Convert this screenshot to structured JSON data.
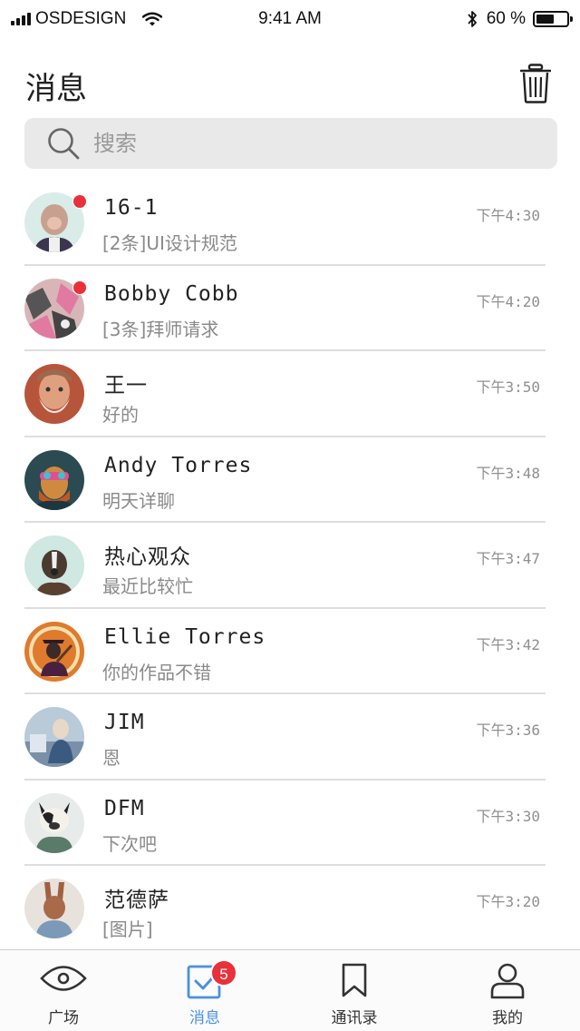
{
  "status_bar": {
    "carrier": "OSDESIGN",
    "time": "9:41 AM",
    "battery": "60 %",
    "battery_level": 0.6
  },
  "header": {
    "title": "消息",
    "trash_icon": "trash-icon"
  },
  "search": {
    "placeholder": "搜索",
    "icon": "search-icon"
  },
  "conversations": [
    {
      "name": "16-1",
      "message": "[2条]UI设计规范",
      "time": "下午4:30",
      "unread": true,
      "bg": "#d9ece8"
    },
    {
      "name": "Bobby Cobb",
      "message": "[3条]拜师请求",
      "time": "下午4:20",
      "unread": true,
      "bg": "#d8b6b8"
    },
    {
      "name": "王一",
      "message": "好的",
      "time": "下午3:50",
      "unread": false,
      "bg": "#b7553a"
    },
    {
      "name": "Andy Torres",
      "message": "明天详聊",
      "time": "下午3:48",
      "unread": false,
      "bg": "#2c4a52"
    },
    {
      "name": "热心观众",
      "message": "最近比较忙",
      "time": "下午3:47",
      "unread": false,
      "bg": "#cfe8e1"
    },
    {
      "name": "Ellie Torres",
      "message": "你的作品不错",
      "time": "下午3:42",
      "unread": false,
      "bg": "#e07a2c"
    },
    {
      "name": "JIM",
      "message": "恩",
      "time": "下午3:36",
      "unread": false,
      "bg": "#b9cad8"
    },
    {
      "name": "DFM",
      "message": "下次吧",
      "time": "下午3:30",
      "unread": false,
      "bg": "#e7ebe9"
    },
    {
      "name": "范德萨",
      "message": "[图片]",
      "time": "下午3:20",
      "unread": false,
      "bg": "#e8e2dc"
    }
  ],
  "tabs": [
    {
      "label": "广场",
      "icon": "eye-icon",
      "active": false
    },
    {
      "label": "消息",
      "icon": "checkbox-icon",
      "active": true,
      "badge": "5"
    },
    {
      "label": "通讯录",
      "icon": "bookmark-icon",
      "active": false
    },
    {
      "label": "我的",
      "icon": "user-icon",
      "active": false
    }
  ],
  "colors": {
    "accent": "#4a90e2",
    "badge": "#e8313a",
    "search_bg": "#e9e9e9"
  }
}
